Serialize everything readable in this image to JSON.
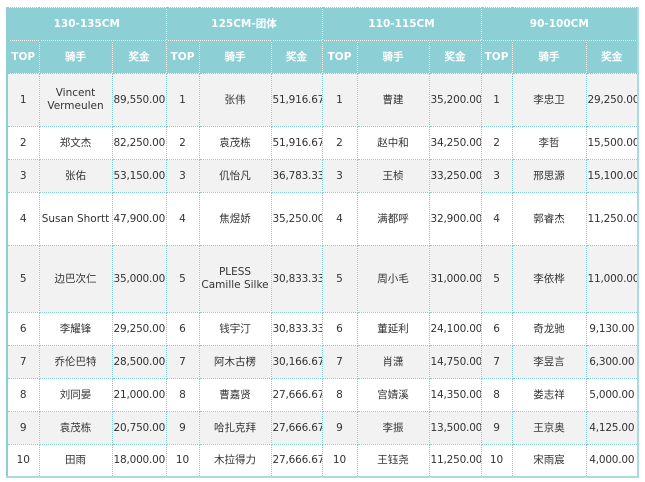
{
  "colors": {
    "header_bg": "#8ccfd4",
    "border": "#7fcfd0",
    "row_alt": "#f2f2f2"
  },
  "groups": [
    {
      "title": "130-135CM",
      "col_top": "TOP",
      "col_rider": "骑手",
      "col_prize": "奖金",
      "rows": [
        {
          "rank": "1",
          "rider": "Vincent Vermeulen",
          "prize": "89,550.00"
        },
        {
          "rank": "2",
          "rider": "郑文杰",
          "prize": "82,250.00"
        },
        {
          "rank": "3",
          "rider": "张佑",
          "prize": "53,150.00"
        },
        {
          "rank": "4",
          "rider": "Susan Shortt",
          "prize": "47,900.00"
        },
        {
          "rank": "5",
          "rider": "边巴次仁",
          "prize": "35,000.00"
        },
        {
          "rank": "6",
          "rider": "李耀锋",
          "prize": "29,250.00"
        },
        {
          "rank": "7",
          "rider": "乔伦巴特",
          "prize": "28,500.00"
        },
        {
          "rank": "8",
          "rider": "刘同晏",
          "prize": "21,000.00"
        },
        {
          "rank": "9",
          "rider": "袁茂栋",
          "prize": "20,750.00"
        },
        {
          "rank": "10",
          "rider": "田雨",
          "prize": "18,000.00"
        }
      ]
    },
    {
      "title": "125CM-团体",
      "col_top": "TOP",
      "col_rider": "骑手",
      "col_prize": "奖金",
      "rows": [
        {
          "rank": "1",
          "rider": "张伟",
          "prize": "51,916.67"
        },
        {
          "rank": "2",
          "rider": "袁茂栋",
          "prize": "51,916.67"
        },
        {
          "rank": "3",
          "rider": "仉怡凡",
          "prize": "36,783.33"
        },
        {
          "rank": "4",
          "rider": "焦煜娇",
          "prize": "35,250.00"
        },
        {
          "rank": "5",
          "rider": "PLESS Camille Silke",
          "prize": "30,833.33"
        },
        {
          "rank": "6",
          "rider": "钱宇汀",
          "prize": "30,833.33"
        },
        {
          "rank": "7",
          "rider": "阿木古楞",
          "prize": "30,166.67"
        },
        {
          "rank": "8",
          "rider": "曹嘉贤",
          "prize": "27,666.67"
        },
        {
          "rank": "9",
          "rider": "哈扎克拜",
          "prize": "27,666.67"
        },
        {
          "rank": "10",
          "rider": "木拉得力",
          "prize": "27,666.67"
        }
      ]
    },
    {
      "title": "110-115CM",
      "col_top": "TOP",
      "col_rider": "骑手",
      "col_prize": "奖金",
      "rows": [
        {
          "rank": "1",
          "rider": "曹建",
          "prize": "35,200.00"
        },
        {
          "rank": "2",
          "rider": "赵中和",
          "prize": "34,250.00"
        },
        {
          "rank": "3",
          "rider": "王桢",
          "prize": "33,250.00"
        },
        {
          "rank": "4",
          "rider": "满都呼",
          "prize": "32,900.00"
        },
        {
          "rank": "5",
          "rider": "周小毛",
          "prize": "31,000.00"
        },
        {
          "rank": "6",
          "rider": "董延利",
          "prize": "24,100.00"
        },
        {
          "rank": "7",
          "rider": "肖潇",
          "prize": "14,750.00"
        },
        {
          "rank": "8",
          "rider": "宫婧溪",
          "prize": "14,350.00"
        },
        {
          "rank": "9",
          "rider": "李振",
          "prize": "13,500.00"
        },
        {
          "rank": "10",
          "rider": "王钰尧",
          "prize": "11,250.00"
        }
      ]
    },
    {
      "title": "90-100CM",
      "col_top": "TOP",
      "col_rider": "骑手",
      "col_prize": "奖金",
      "rows": [
        {
          "rank": "1",
          "rider": "李忠卫",
          "prize": "29,250.00"
        },
        {
          "rank": "2",
          "rider": "李哲",
          "prize": "15,500.00"
        },
        {
          "rank": "3",
          "rider": "邢思源",
          "prize": "15,100.00"
        },
        {
          "rank": "4",
          "rider": "郭睿杰",
          "prize": "11,250.00"
        },
        {
          "rank": "5",
          "rider": "李依桦",
          "prize": "11,000.00"
        },
        {
          "rank": "6",
          "rider": "奇龙驰",
          "prize": "9,130.00"
        },
        {
          "rank": "7",
          "rider": "李昱言",
          "prize": "6,300.00"
        },
        {
          "rank": "8",
          "rider": "娄志祥",
          "prize": "5,000.00"
        },
        {
          "rank": "9",
          "rider": "王京奥",
          "prize": "4,125.00"
        },
        {
          "rank": "10",
          "rider": "宋雨宸",
          "prize": "4,000.00"
        }
      ]
    }
  ]
}
